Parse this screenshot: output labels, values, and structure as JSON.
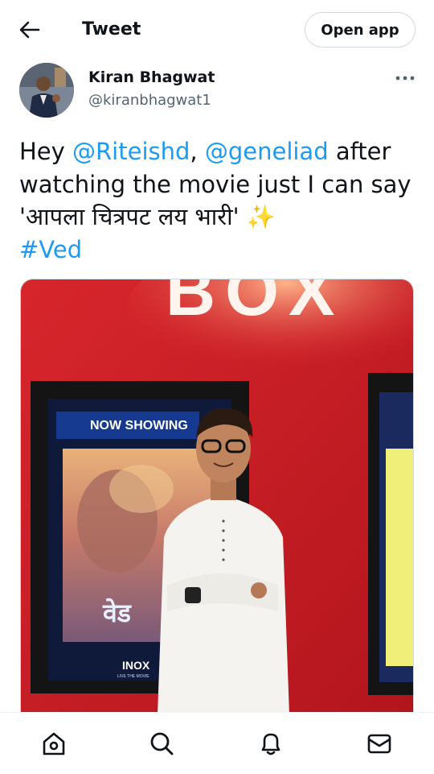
{
  "header": {
    "title": "Tweet",
    "open_app_label": "Open app",
    "back_icon": "arrow-left-icon"
  },
  "tweet": {
    "author_name": "Kiran Bhagwat",
    "author_handle": "@kiranbhagwat1",
    "text_parts": {
      "p1": "Hey ",
      "mention1": "@Riteishd",
      "p2": ", ",
      "mention2": "@geneliad",
      "p3": " after watching the movie just I can say 'आपला चित्रपट लय भारी' ",
      "emoji": "✨",
      "hashtag": "#Ved"
    },
    "media": {
      "sign_text": "BOX",
      "poster_banner": "NOW SHOWING",
      "poster_title": "वेड",
      "poster_brand": "INOX",
      "poster_tagline": "LIVE THE MOVIE"
    }
  },
  "nav": {
    "items": [
      {
        "icon": "home-icon"
      },
      {
        "icon": "search-icon"
      },
      {
        "icon": "bell-icon"
      },
      {
        "icon": "mail-icon"
      }
    ]
  },
  "colors": {
    "accent": "#1d9bf0",
    "text": "#0f1419",
    "secondary_text": "#536471",
    "wall_red": "#c81d25"
  }
}
